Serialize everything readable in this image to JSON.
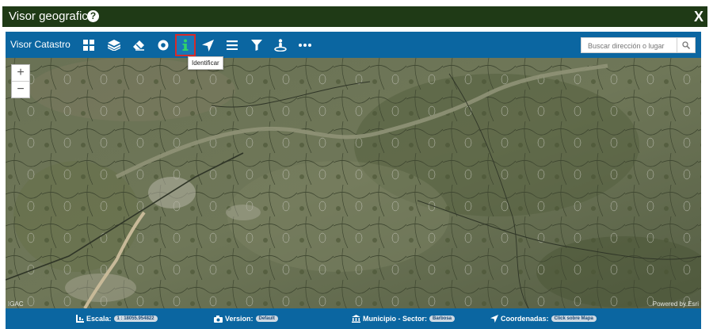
{
  "window": {
    "title": "Visor geografico",
    "help_symbol": "?",
    "close_label": "X"
  },
  "toolbar": {
    "app_name": "Visor Catastro",
    "tools": [
      {
        "name": "grid-icon"
      },
      {
        "name": "layers-icon"
      },
      {
        "name": "eraser-icon"
      },
      {
        "name": "target-icon"
      },
      {
        "name": "info-icon",
        "active": true,
        "tooltip": "Identificar"
      },
      {
        "name": "navigate-arrow-icon"
      },
      {
        "name": "menu-lines-icon"
      },
      {
        "name": "filter-icon"
      },
      {
        "name": "street-view-icon"
      },
      {
        "name": "more-dots-icon"
      }
    ],
    "search_placeholder": "Buscar dirección o lugar"
  },
  "map": {
    "attribution_left": "IGAC",
    "attribution_right": "Powered by Esri"
  },
  "status": {
    "scale_label": "Escala:",
    "scale_value": "1 : 18055.954822",
    "version_label": "Version:",
    "version_value": "Default",
    "municipio_label": "Municipio - Sector:",
    "municipio_value": "Barbosa",
    "coord_label": "Coordenadas:",
    "coord_value": "Click sobre Mapa"
  },
  "colors": {
    "header_dark": "#1f3a16",
    "toolbar_blue": "#0b66a1",
    "active_border": "#d72a2a"
  }
}
